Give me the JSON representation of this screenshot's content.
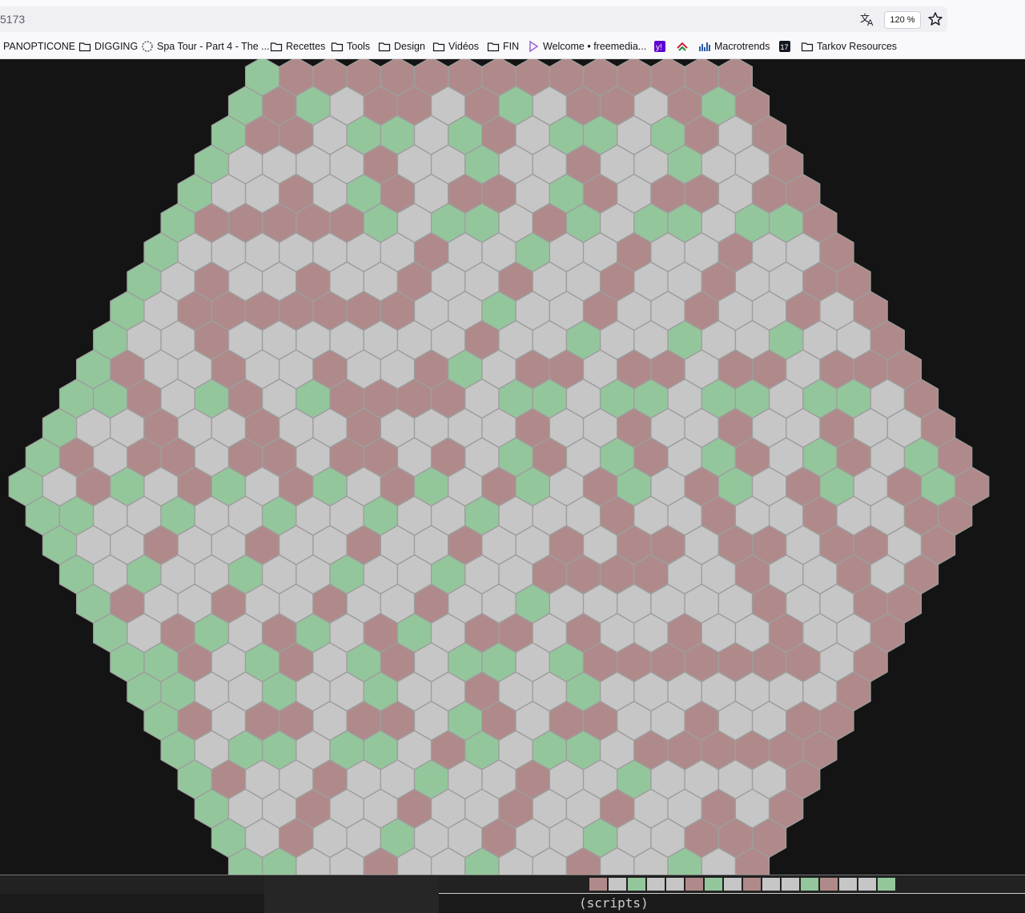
{
  "browser": {
    "url_text": "5173",
    "zoom_label": "120 %",
    "bookmarks": [
      {
        "label": "PANOPTICONE",
        "icon": "none"
      },
      {
        "label": "DIGGING",
        "icon": "folder-icon"
      },
      {
        "label": "Spa Tour - Part 4 - The ...",
        "icon": "site-favicon-icon"
      },
      {
        "label": "Recettes",
        "icon": "folder-icon"
      },
      {
        "label": "Tools",
        "icon": "folder-icon"
      },
      {
        "label": "Design",
        "icon": "folder-icon"
      },
      {
        "label": "Vidéos",
        "icon": "folder-icon"
      },
      {
        "label": "FIN",
        "icon": "folder-icon"
      },
      {
        "label": "Welcome • freemedia...",
        "icon": "play-favicon-icon"
      },
      {
        "label": "",
        "icon": "yahoo-favicon-icon"
      },
      {
        "label": "",
        "icon": "chevron-favicon-icon"
      },
      {
        "label": "Macrotrends",
        "icon": "bars-favicon-icon"
      },
      {
        "label": "",
        "icon": "tv-favicon-icon"
      },
      {
        "label": "Tarkov Resources",
        "icon": "folder-icon"
      }
    ]
  },
  "hex_board": {
    "colors": {
      "gray": "#c6c6c6",
      "red": "#b08a8a",
      "green": "#93c79b",
      "background": "#141414",
      "cell_stroke": "#9e9e9e"
    }
  },
  "devtools": {
    "panel_label": "(scripts)"
  }
}
